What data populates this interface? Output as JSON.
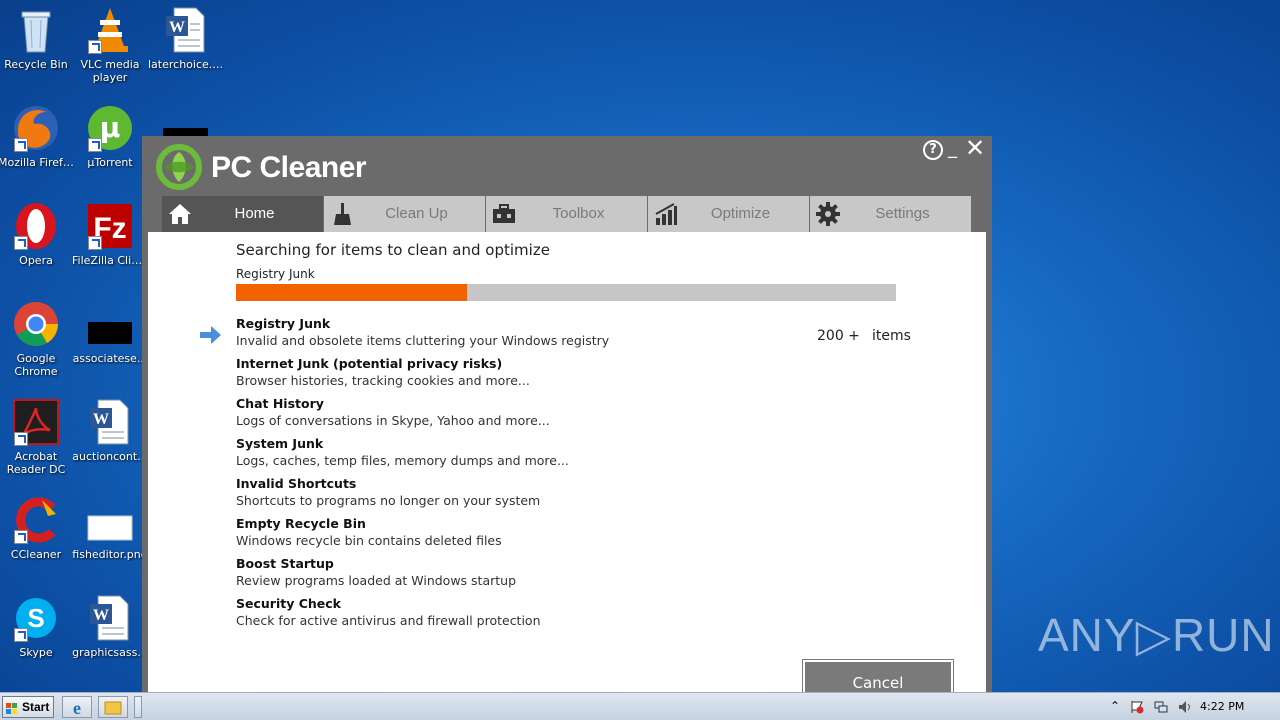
{
  "desktop": {
    "icons": [
      {
        "label": "Recycle Bin"
      },
      {
        "label": "VLC media player"
      },
      {
        "label": "laterchoice.rtf"
      },
      {
        "label": "Mozilla Firefox"
      },
      {
        "label": "µTorrent"
      },
      {
        "label": "Opera"
      },
      {
        "label": "FileZilla Client"
      },
      {
        "label": "Google Chrome"
      },
      {
        "label": "associatese..."
      },
      {
        "label": "Acrobat Reader DC"
      },
      {
        "label": "auctioncont..."
      },
      {
        "label": "CCleaner"
      },
      {
        "label": "fisheditor.png"
      },
      {
        "label": "Skype"
      },
      {
        "label": "graphicsass..."
      }
    ]
  },
  "app": {
    "title": "PC Cleaner",
    "help_glyph": "?",
    "minimize_glyph": "_",
    "close_glyph": "✕",
    "tabs": [
      {
        "label": "Home",
        "icon": "home-icon",
        "active": true
      },
      {
        "label": "Clean Up",
        "icon": "broom-icon",
        "active": false
      },
      {
        "label": "Toolbox",
        "icon": "toolbox-icon",
        "active": false
      },
      {
        "label": "Optimize",
        "icon": "bar-chart-icon",
        "active": false
      },
      {
        "label": "Settings",
        "icon": "gear-icon",
        "active": false
      }
    ],
    "scan": {
      "heading": "Searching for items to clean and optimize",
      "current_item": "Registry Junk",
      "progress": 0.35
    },
    "items": [
      {
        "title": "Registry Junk",
        "desc": "Invalid and obsolete items cluttering your Windows registry"
      },
      {
        "title": "Internet Junk (potential privacy risks)",
        "desc": "Browser histories, tracking cookies and more..."
      },
      {
        "title": "Chat History",
        "desc": "Logs of conversations in Skype, Yahoo and more..."
      },
      {
        "title": "System Junk",
        "desc": "Logs, caches, temp files, memory dumps and more..."
      },
      {
        "title": "Invalid Shortcuts",
        "desc": "Shortcuts to programs no longer on your system"
      },
      {
        "title": "Empty Recycle Bin",
        "desc": "Windows recycle bin contains deleted files"
      },
      {
        "title": "Boost Startup",
        "desc": "Review programs loaded at Windows startup"
      },
      {
        "title": "Security Check",
        "desc": "Check for active antivirus and firewall protection"
      }
    ],
    "count_value": "200 +",
    "count_unit": "items",
    "cancel_label": "Cancel",
    "colors": {
      "progress": "#f26200",
      "accent": "#4a8fdc",
      "logo": "#6dbb3a"
    }
  },
  "watermark": "ANY▷RUN",
  "taskbar": {
    "start_label": "Start",
    "clock": "4:22 PM",
    "tray_arrow": "⌃"
  }
}
